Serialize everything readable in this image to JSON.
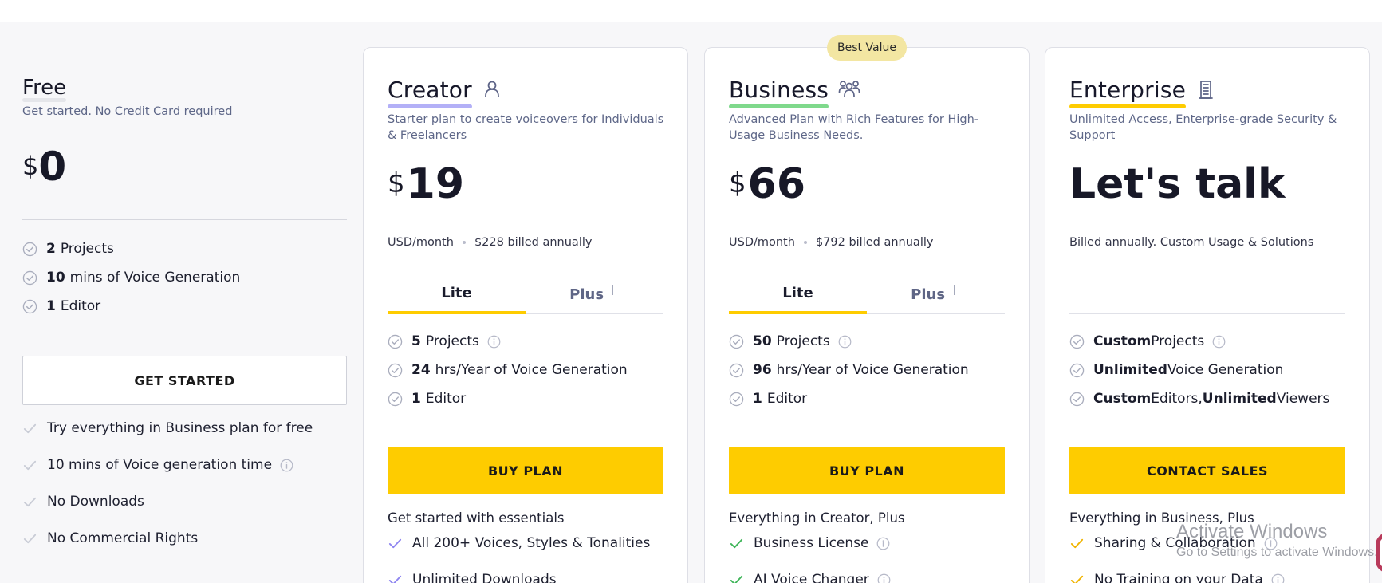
{
  "free": {
    "title": "Free",
    "desc": "Get started. No Credit Card required",
    "currency": "$",
    "amount": "0",
    "features": [
      {
        "bold": "2",
        "text": "Projects"
      },
      {
        "bold": "10",
        "text": "mins of Voice Generation"
      },
      {
        "bold": "1",
        "text": "Editor"
      }
    ],
    "button": "GET STARTED",
    "extras": [
      {
        "text": "Try everything in Business plan for free",
        "info": false
      },
      {
        "text": "10 mins of Voice generation time",
        "info": true
      },
      {
        "text": "No Downloads",
        "info": false
      },
      {
        "text": "No Commercial Rights",
        "info": false
      }
    ]
  },
  "creator": {
    "name": "Creator",
    "icon": "person-icon",
    "underline_color": "#b3b0f7",
    "desc": "Starter plan to create voiceovers for Individuals & Freelancers",
    "currency": "$",
    "amount": "19",
    "billing_unit": "USD/month",
    "billing_annual": "$228 billed annually",
    "tabs": [
      "Lite",
      "Plus"
    ],
    "features": [
      {
        "bold": "5",
        "text": "Projects",
        "info": true
      },
      {
        "bold": "24",
        "text": "hrs/Year of Voice Generation",
        "info": false
      },
      {
        "bold": "1",
        "text": "Editor",
        "info": false
      }
    ],
    "button": "BUY PLAN",
    "included": "Get started with essentials",
    "extras_tick_color": "#8e85f0",
    "extras": [
      {
        "text": "All 200+ Voices, Styles & Tonalities",
        "info": false
      },
      {
        "text": "Unlimited Downloads",
        "info": false
      }
    ]
  },
  "business": {
    "badge": "Best Value",
    "name": "Business",
    "icon": "group-icon",
    "underline_color": "#7fd98c",
    "desc": "Advanced Plan with Rich Features for High-Usage Business Needs.",
    "currency": "$",
    "amount": "66",
    "billing_unit": "USD/month",
    "billing_annual": "$792 billed annually",
    "tabs": [
      "Lite",
      "Plus"
    ],
    "features": [
      {
        "bold": "50",
        "text": "Projects",
        "info": true
      },
      {
        "bold": "96",
        "text": "hrs/Year of Voice Generation",
        "info": false
      },
      {
        "bold": "1",
        "text": "Editor",
        "info": false
      }
    ],
    "button": "BUY PLAN",
    "included": "Everything in Creator, Plus",
    "extras_tick_color": "#3fb559",
    "extras": [
      {
        "text": "Business License",
        "info": true
      },
      {
        "text": "AI Voice Changer",
        "info": true
      }
    ]
  },
  "enterprise": {
    "name": "Enterprise",
    "icon": "building-icon",
    "underline_color": "#fecc00",
    "desc": "Unlimited Access, Enterprise-grade Security & Support",
    "price_text": "Let's talk",
    "billing": "Billed annually. Custom Usage & Solutions",
    "features": [
      {
        "parts": [
          {
            "b": "Custom"
          },
          {
            "t": " Projects"
          }
        ],
        "info": true
      },
      {
        "parts": [
          {
            "b": "Unlimited"
          },
          {
            "t": " Voice Generation"
          }
        ],
        "info": false
      },
      {
        "parts": [
          {
            "b": "Custom"
          },
          {
            "t": " Editors, "
          },
          {
            "b": "Unlimited"
          },
          {
            "t": " Viewers"
          }
        ],
        "info": false
      }
    ],
    "button": "CONTACT SALES",
    "included": "Everything in Business, Plus",
    "extras_tick_color": "#f0b400",
    "extras": [
      {
        "text": "Sharing & Collaboration",
        "info": true
      },
      {
        "text": "No Training on your Data",
        "info": true
      }
    ]
  },
  "watermark": {
    "line1": "Activate Windows",
    "line2": "Go to Settings to activate Windows."
  },
  "colors": {
    "accent": "#fecc00",
    "badge_bg": "#f3e6a2"
  }
}
